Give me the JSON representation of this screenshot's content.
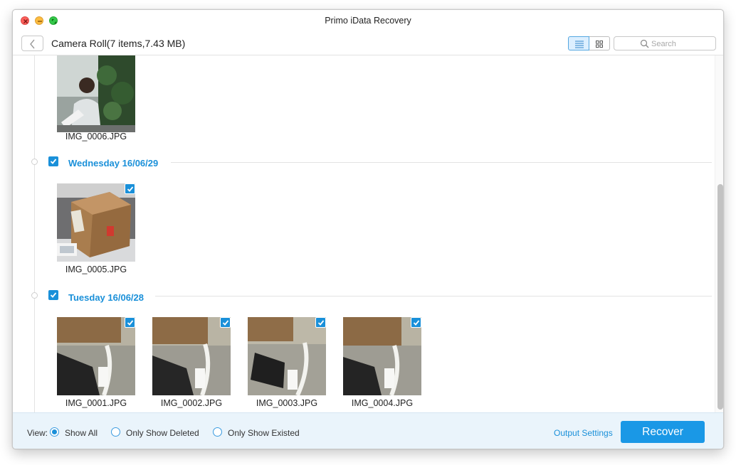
{
  "window": {
    "title": "Primo iData Recovery"
  },
  "toolbar": {
    "location": "Camera Roll(7 items,7.43 MB)",
    "search_placeholder": "Search"
  },
  "groups": [
    {
      "title": "",
      "items": [
        {
          "filename": "IMG_0006.JPG",
          "selected": false,
          "icon": "person-photo"
        }
      ]
    },
    {
      "title": "Wednesday 16/06/29",
      "selected": true,
      "items": [
        {
          "filename": "IMG_0005.JPG",
          "selected": true,
          "icon": "box-photo"
        }
      ]
    },
    {
      "title": "Tuesday 16/06/28",
      "selected": true,
      "items": [
        {
          "filename": "IMG_0001.JPG",
          "selected": true,
          "icon": "phone-cable-photo"
        },
        {
          "filename": "IMG_0002.JPG",
          "selected": true,
          "icon": "phone-cable-photo"
        },
        {
          "filename": "IMG_0003.JPG",
          "selected": true,
          "icon": "phone-cable-photo"
        },
        {
          "filename": "IMG_0004.JPG",
          "selected": true,
          "icon": "phone-cable-photo"
        }
      ]
    }
  ],
  "footer": {
    "view_label": "View:",
    "filters": [
      {
        "label": "Show All",
        "selected": true
      },
      {
        "label": "Only Show Deleted",
        "selected": false
      },
      {
        "label": "Only Show Existed",
        "selected": false
      }
    ],
    "output_settings": "Output Settings",
    "recover": "Recover"
  },
  "colors": {
    "accent": "#1a90d9",
    "footer_bg": "#eaf4fb",
    "recover_bg": "#1a98e6"
  }
}
